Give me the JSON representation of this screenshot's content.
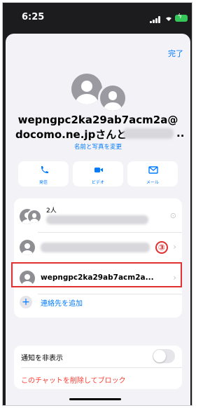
{
  "status": {
    "time": "6:25"
  },
  "header": {
    "done_label": "完了"
  },
  "contact": {
    "name_line1": "wepngpc2ka29ab7acm2a@",
    "name_line2": "docomo.ne.jpさんと",
    "name_trailing": "..",
    "edit_label": "名前と写真を変更"
  },
  "actions": [
    {
      "label": "発信",
      "icon": "phone-icon"
    },
    {
      "label": "ビデオ",
      "icon": "video-icon"
    },
    {
      "label": "メール",
      "icon": "mail-icon"
    }
  ],
  "members": {
    "group_count_label": "2人",
    "annotation_number": "③",
    "highlighted_member": "wepngpc2ka29ab7acm2a...",
    "add_contact_label": "連絡先を追加"
  },
  "settings": {
    "hide_alerts_label": "通知を非表示",
    "hide_alerts_on": false,
    "delete_block_label": "このチャットを削除してブロック"
  },
  "colors": {
    "accent": "#007aff",
    "danger": "#ff3b30",
    "annotation": "#e03030"
  }
}
